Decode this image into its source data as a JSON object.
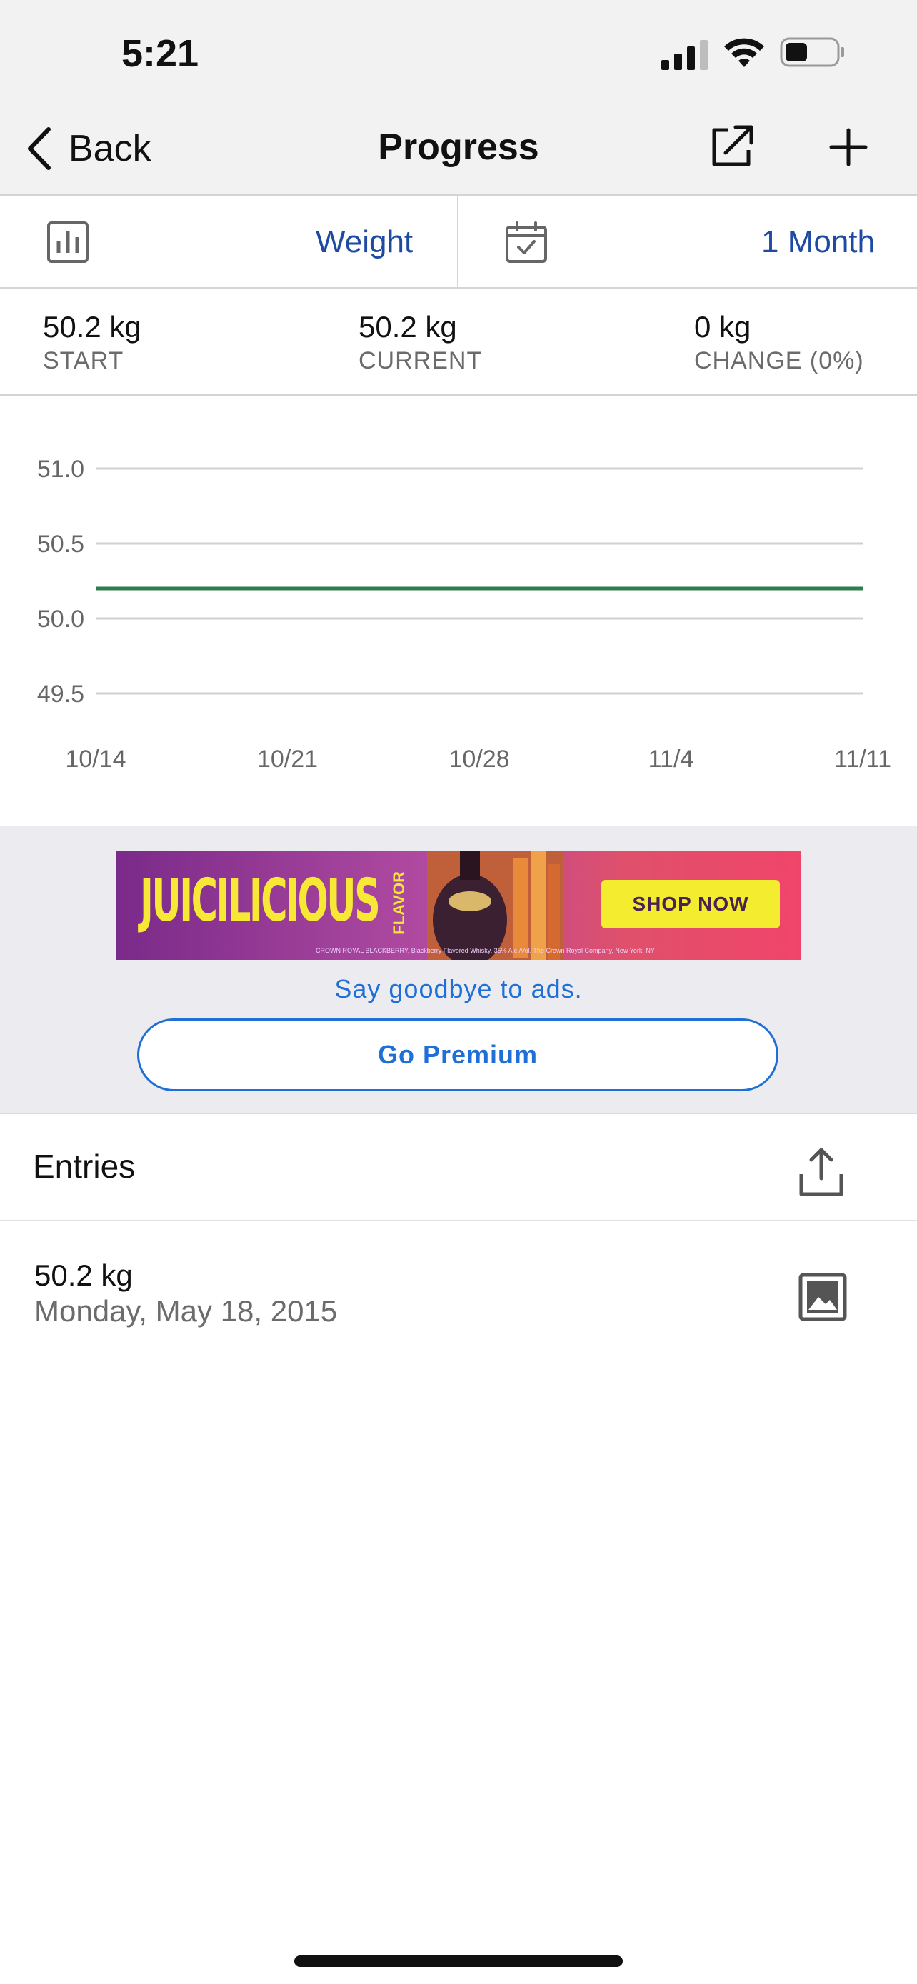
{
  "status_bar": {
    "time": "5:21"
  },
  "nav": {
    "back_label": "Back",
    "title": "Progress"
  },
  "selectors": {
    "metric_label": "Weight",
    "range_label": "1 Month"
  },
  "stats": [
    {
      "value": "50.2 kg",
      "label": "START"
    },
    {
      "value": "50.2 kg",
      "label": "CURRENT"
    },
    {
      "value": "0 kg",
      "label": "CHANGE (0%)"
    }
  ],
  "chart_data": {
    "type": "line",
    "x": [
      "10/14",
      "10/21",
      "10/28",
      "11/4",
      "11/11"
    ],
    "y_ticks": [
      "51.0",
      "50.5",
      "50.0",
      "49.5"
    ],
    "ylim": [
      49.5,
      51.0
    ],
    "series": [
      {
        "values": [
          50.2,
          50.2,
          50.2,
          50.2,
          50.2
        ],
        "color": "#2e7d4f"
      }
    ],
    "grid": true
  },
  "ad": {
    "headline": "JUICILICIOUS",
    "flavor": "FLAVOR",
    "bottle_text": "Crown Royal BLACKBERRY",
    "cta": "SHOP NOW",
    "fine_print": "CROWN ROYAL BLACKBERRY, Blackberry Flavored Whisky, 35% Alc./Vol. The Crown Royal Company, New York, NY",
    "remove_ads_text": "Say goodbye to ads.",
    "premium_button": "Go Premium"
  },
  "entries": {
    "title": "Entries",
    "items": [
      {
        "value": "50.2 kg",
        "date": "Monday, May 18, 2015"
      }
    ]
  },
  "colors": {
    "accent": "#1f4aa3",
    "link": "#1f6fd6",
    "line": "#2e7d4f"
  }
}
